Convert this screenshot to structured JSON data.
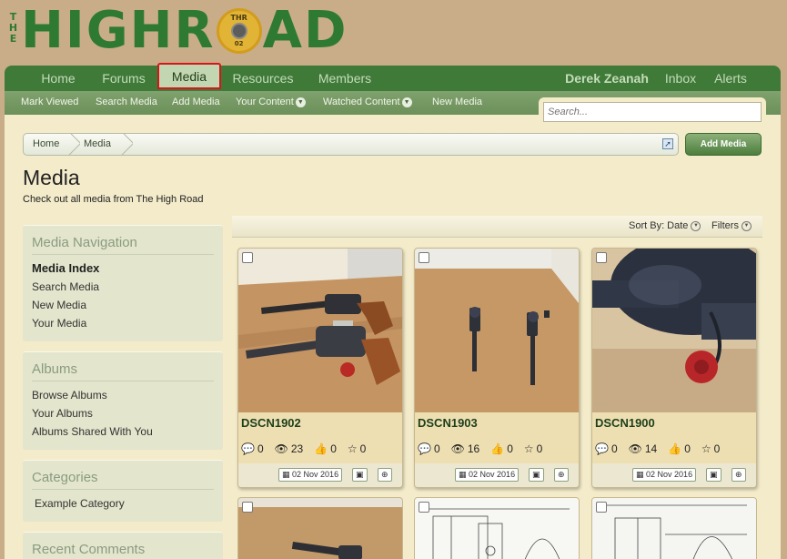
{
  "logo": {
    "the": "THE",
    "word_left": "HIGHR",
    "word_right": "AD",
    "badge_top": "THR",
    "badge_bottom": "02"
  },
  "nav": {
    "tabs": [
      "Home",
      "Forums",
      "Media",
      "Resources",
      "Members"
    ],
    "user": "Derek Zeanah",
    "inbox": "Inbox",
    "alerts": "Alerts"
  },
  "subnav": {
    "items": [
      "Mark Viewed",
      "Search Media",
      "Add Media",
      "Your Content",
      "Watched Content",
      "New Media"
    ],
    "search_placeholder": "Search..."
  },
  "breadcrumb": {
    "home": "Home",
    "media": "Media",
    "jump_icon": "jump-arrow-icon"
  },
  "add_media_label": "Add Media",
  "page": {
    "title": "Media",
    "description": "Check out all media from The High Road"
  },
  "sidebar": {
    "navigation": {
      "title": "Media Navigation",
      "links": [
        "Media Index",
        "Search Media",
        "New Media",
        "Your Media"
      ]
    },
    "albums": {
      "title": "Albums",
      "links": [
        "Browse Albums",
        "Your Albums",
        "Albums Shared With You"
      ]
    },
    "categories": {
      "title": "Categories",
      "links": [
        "Example Category"
      ]
    },
    "recent_comments": {
      "title": "Recent Comments"
    }
  },
  "sort": {
    "sort_label": "Sort By: Date",
    "filters_label": "Filters"
  },
  "media": [
    {
      "title": "DSCN1902",
      "comments": "0",
      "views": "23",
      "likes": "0",
      "rating": "0",
      "date": "02 Nov 2016"
    },
    {
      "title": "DSCN1903",
      "comments": "0",
      "views": "16",
      "likes": "0",
      "rating": "0",
      "date": "02 Nov 2016"
    },
    {
      "title": "DSCN1900",
      "comments": "0",
      "views": "14",
      "likes": "0",
      "rating": "0",
      "date": "02 Nov 2016"
    }
  ],
  "colors": {
    "nav_green": "#3f7a39",
    "subnav_green": "#7fa26e",
    "body_tan": "#c9ad88",
    "content_cream": "#f3ebca",
    "active_tab_outline": "#d9141a"
  }
}
